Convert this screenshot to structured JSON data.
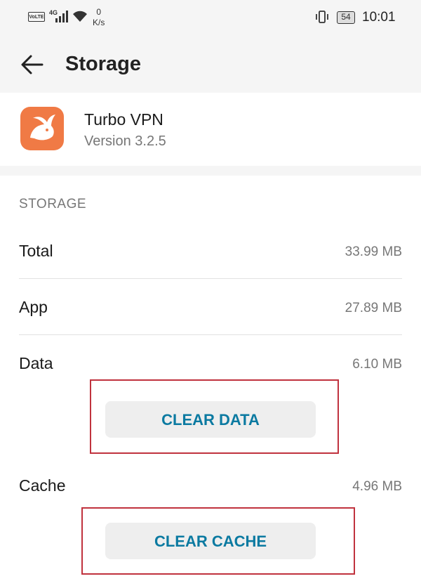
{
  "status_bar": {
    "volte": "VoLTE",
    "network": "4G",
    "speed_value": "0",
    "speed_unit": "K/s",
    "battery": "54",
    "time": "10:01"
  },
  "app_bar": {
    "title": "Storage"
  },
  "app_info": {
    "name": "Turbo VPN",
    "version": "Version 3.2.5"
  },
  "storage": {
    "section_header": "STORAGE",
    "rows": [
      {
        "label": "Total",
        "value": "33.99 MB"
      },
      {
        "label": "App",
        "value": "27.89 MB"
      },
      {
        "label": "Data",
        "value": "6.10 MB"
      },
      {
        "label": "Cache",
        "value": "4.96 MB"
      }
    ],
    "clear_data_label": "CLEAR DATA",
    "clear_cache_label": "CLEAR CACHE"
  },
  "colors": {
    "accent": "#0b7aa1",
    "app_icon": "#f07a45",
    "highlight": "#c0323e"
  }
}
